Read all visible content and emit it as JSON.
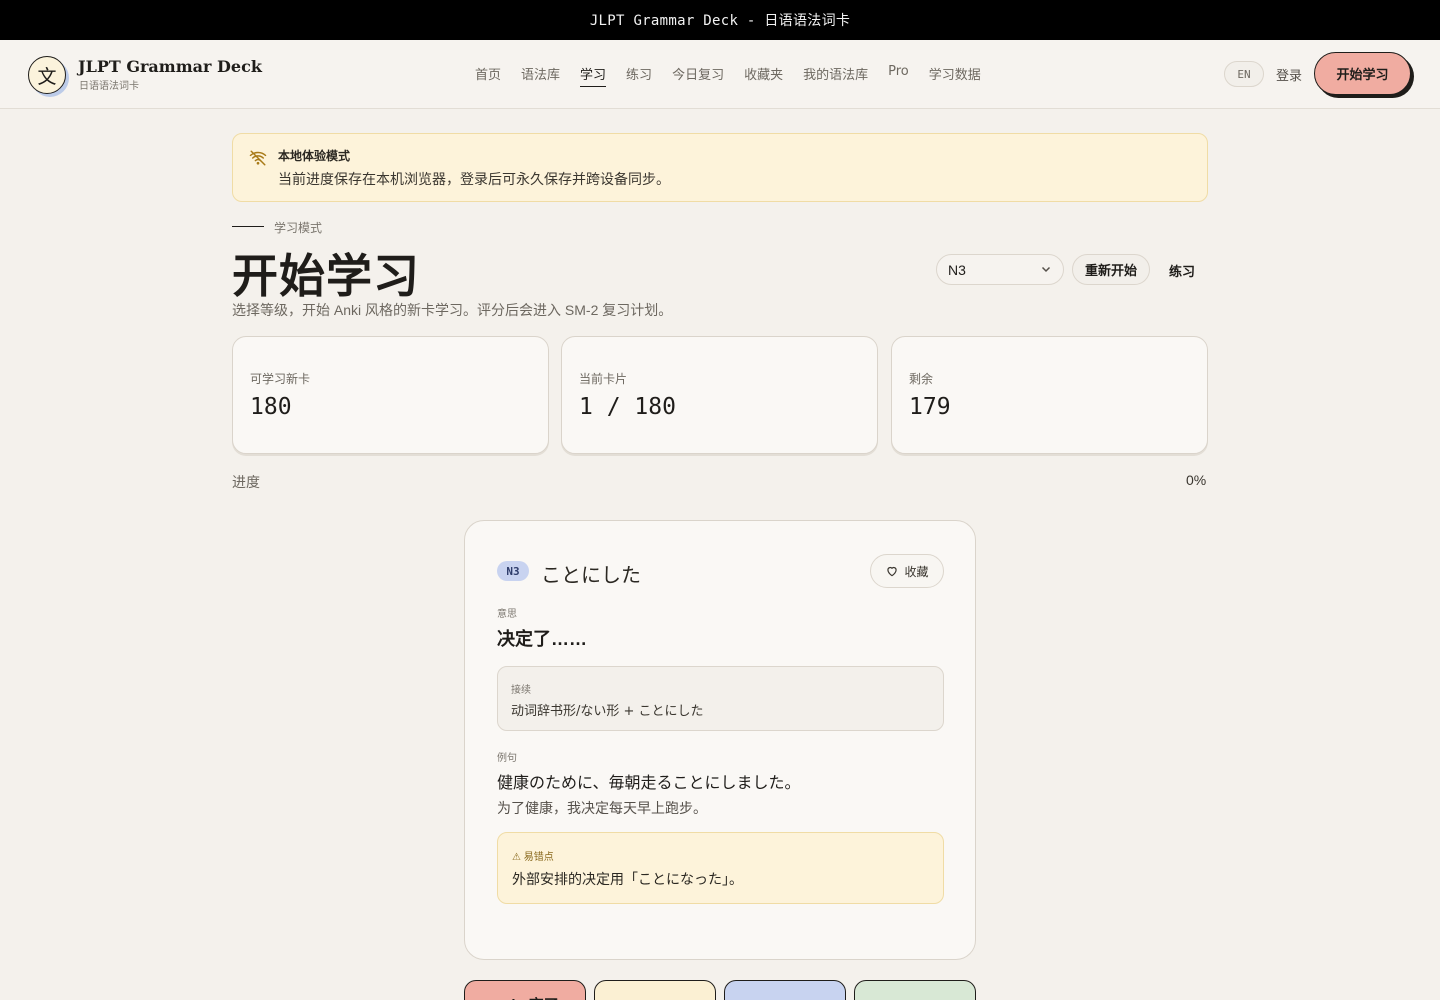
{
  "window": {
    "title": "JLPT Grammar Deck - 日语语法词卡"
  },
  "header": {
    "logo_glyph": "文",
    "brand_name": "JLPT Grammar Deck",
    "brand_sub": "日语语法词卡",
    "nav": [
      {
        "label": "首页",
        "active": false
      },
      {
        "label": "语法库",
        "active": false
      },
      {
        "label": "学习",
        "active": true
      },
      {
        "label": "练习",
        "active": false
      },
      {
        "label": "今日复习",
        "active": false
      },
      {
        "label": "收藏夹",
        "active": false
      },
      {
        "label": "我的语法库",
        "active": false
      },
      {
        "label": "Pro",
        "active": false
      },
      {
        "label": "学习数据",
        "active": false
      }
    ],
    "lang": "EN",
    "login": "登录",
    "cta": "开始学习"
  },
  "notice": {
    "icon": "wifi-off-icon",
    "title": "本地体验模式",
    "text": "当前进度保存在本机浏览器，登录后可永久保存并跨设备同步。"
  },
  "page": {
    "eyebrow": "学习模式",
    "title": "开始学习",
    "description": "选择等级，开始 Anki 风格的新卡学习。评分后会进入 SM-2 复习计划。",
    "level_selected": "N3",
    "restart": "重新开始",
    "practice": "练习"
  },
  "stats": [
    {
      "label": "可学习新卡",
      "value": "180"
    },
    {
      "label": "当前卡片",
      "value": "1 / 180"
    },
    {
      "label": "剩余",
      "value": "179"
    }
  ],
  "progress": {
    "label": "进度",
    "value": "0%",
    "fraction": 0
  },
  "card": {
    "level": "N3",
    "grammar": "ことにした",
    "favorite": "收藏",
    "meaning_label": "意思",
    "meaning": "决定了……",
    "connection_label": "接续",
    "connection": "动词辞书形/ない形 + ことにした",
    "example_label": "例句",
    "example_jp": "健康のために、毎朝走ることにしました。",
    "example_cn": "为了健康，我决定每天早上跑步。",
    "warning_label": "⚠ 易错点",
    "warning": "外部安排的决定用「ことになった」。"
  },
  "rating": [
    {
      "label": "Again 忘了",
      "color": "#f0aca1"
    },
    {
      "label": "",
      "color": "#fbf0d3"
    },
    {
      "label": "",
      "color": "#c8d3f0"
    },
    {
      "label": "",
      "color": "#d8e8d5"
    }
  ],
  "colors": {
    "accent": "#f0aca1",
    "notice": "#fdf3da",
    "badge": "#c8d3f0"
  }
}
